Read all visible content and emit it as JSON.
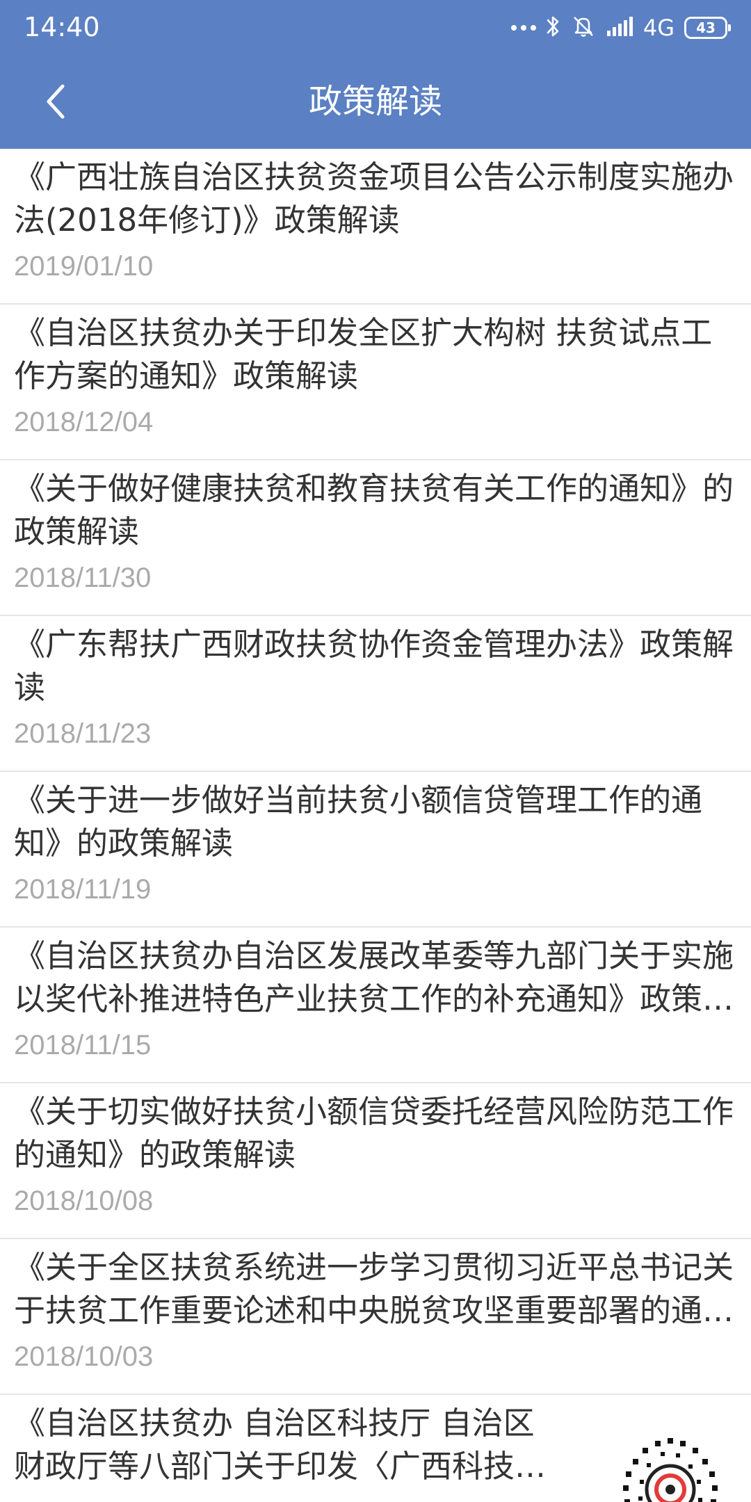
{
  "status_bar": {
    "time": "14:40",
    "network": "4G",
    "battery": "43"
  },
  "header": {
    "title": "政策解读"
  },
  "items": [
    {
      "title": "《广西壮族自治区扶贫资金项目公告公示制度实施办法(2018年修订)》政策解读",
      "date": "2019/01/10"
    },
    {
      "title": "《自治区扶贫办关于印发全区扩大构树 扶贫试点工作方案的通知》政策解读",
      "date": "2018/12/04"
    },
    {
      "title": "《关于做好健康扶贫和教育扶贫有关工作的通知》的政策解读",
      "date": "2018/11/30"
    },
    {
      "title": "《广东帮扶广西财政扶贫协作资金管理办法》政策解读",
      "date": "2018/11/23"
    },
    {
      "title": "《关于进一步做好当前扶贫小额信贷管理工作的通知》的政策解读",
      "date": "2018/11/19"
    },
    {
      "title": "《自治区扶贫办自治区发展改革委等九部门关于实施以奖代补推进特色产业扶贫工作的补充通知》政策解读",
      "date": "2018/11/15"
    },
    {
      "title": "《关于切实做好扶贫小额信贷委托经营风险防范工作的通知》的政策解读",
      "date": "2018/10/08"
    },
    {
      "title": "《关于全区扶贫系统进一步学习贯彻习近平总书记关于扶贫工作重要论述和中央脱贫攻坚重要部署的通知》政策解读",
      "date": "2018/10/03"
    },
    {
      "title": "《自治区扶贫办 自治区科技厅 自治区财政厅等八部门关于印发〈广西科技扶贫行动方案〉的通知》政策解读",
      "date": ""
    }
  ],
  "colors": {
    "header_bg": "#5b80c3",
    "title_text": "#333333",
    "date_text": "#aaaaaa",
    "divider": "#e6e6e6"
  },
  "icons": {
    "back": "chevron-left-icon",
    "bluetooth": "bluetooth-icon",
    "alarm_off": "alarm-off-icon",
    "signal": "signal-bars-icon"
  }
}
